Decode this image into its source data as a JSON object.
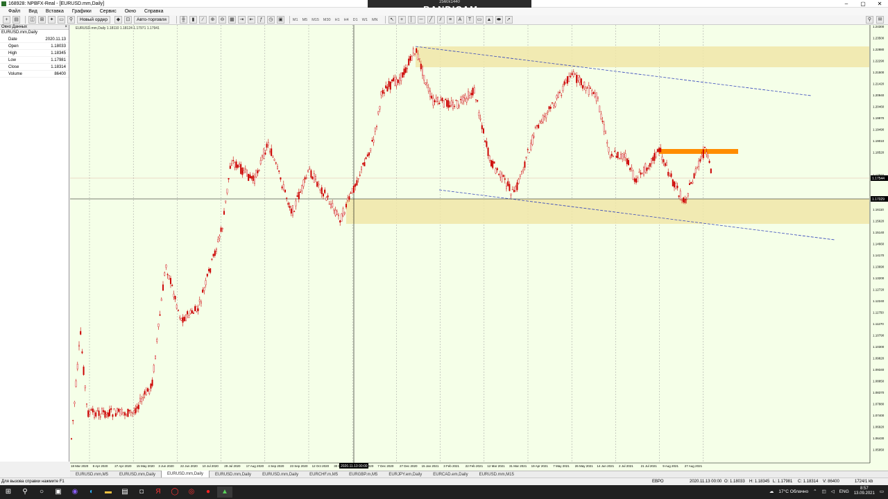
{
  "window": {
    "title": "168928: NPBFX-Real - [EURUSD.mm,Daily]"
  },
  "overlay": {
    "top_text": "2560x1440",
    "brand": "www.BANDICAM.com"
  },
  "menu": [
    "Файл",
    "Вид",
    "Вставка",
    "Графики",
    "Сервис",
    "Окно",
    "Справка"
  ],
  "toolbar": {
    "new_order": "Новый ордер",
    "autotrading": "Авто-торговля",
    "timeframes": [
      "M1",
      "M5",
      "M15",
      "M30",
      "H1",
      "H4",
      "D1",
      "W1",
      "MN"
    ]
  },
  "data_window": {
    "title": "Окно Данных",
    "symbol": "EURUSD.mm,Daily",
    "rows": [
      {
        "label": "Date",
        "value": "2020.11.13"
      },
      {
        "label": "Open",
        "value": "1.18033"
      },
      {
        "label": "High",
        "value": "1.18345"
      },
      {
        "label": "Low",
        "value": "1.17981"
      },
      {
        "label": "Close",
        "value": "1.18314"
      },
      {
        "label": "Volume",
        "value": "86400"
      }
    ]
  },
  "chart": {
    "info": "EURUSD.mm,Daily  1.18110 1.18124 1.17971 1.17941",
    "price_labels": [
      "1.24300",
      "1.23500",
      "1.22880",
      "1.22290",
      "1.21500",
      "1.21420",
      "1.20940",
      "1.20460",
      "1.19970",
      "1.19490",
      "1.19010",
      "1.18520",
      "1.17544",
      "1.17560",
      "1.17029",
      "1.16590",
      "1.16110",
      "1.15620",
      "1.15140",
      "1.14660",
      "1.14170",
      "1.13690",
      "1.13200",
      "1.12720",
      "1.12240",
      "1.11750",
      "1.11270",
      "1.10790",
      "1.10300",
      "1.09820",
      "1.09340",
      "1.08850",
      "1.08370",
      "1.07880",
      "1.07400",
      "1.06920",
      "1.06430",
      "1.05950"
    ],
    "cursor_price": "1.17029",
    "current_price": "1.17544",
    "date_labels": [
      "18 Mar 2020",
      "8 Apr 2020",
      "27 Apr 2020",
      "15 May 2020",
      "3 Jun 2020",
      "22 Jun 2020",
      "10 Jul 2020",
      "29 Jul 2020",
      "17 Aug 2020",
      "4 Sep 2020",
      "23 Sep 2020",
      "12 Oct 2020",
      "30 Oct 2020",
      "19 Nov 2020",
      "7 Dec 2020",
      "27 Dec 2020",
      "15 Jan 2021",
      "3 Feb 2021",
      "22 Feb 2021",
      "12 Mar 2021",
      "31 Mar 2021",
      "19 Apr 2021",
      "7 May 2021",
      "26 May 2021",
      "14 Jun 2021",
      "2 Jul 2021",
      "21 Jul 2021",
      "9 Aug 2021",
      "27 Aug 2021"
    ],
    "cursor_date": "2020.11.13 00:00",
    "colors": {
      "bg": "#f5ffe8",
      "candle": "#cc0000",
      "zone": "#f0e6a8",
      "resistance": "#ff8c00",
      "trendline": "#3344bb"
    }
  },
  "tabs": [
    {
      "label": "EURUSD.mm,M5",
      "active": false
    },
    {
      "label": "EURUSD.mm,Daily",
      "active": false
    },
    {
      "label": "EURUSD.mm,Daily",
      "active": true
    },
    {
      "label": "EURUSD.mm,Daily",
      "active": false
    },
    {
      "label": "EURUSD.mm,Daily",
      "active": false
    },
    {
      "label": "EURCHF.m,M5",
      "active": false
    },
    {
      "label": "EURGBP.m,M5",
      "active": false
    },
    {
      "label": "EURJPY.em,Daily",
      "active": false
    },
    {
      "label": "EURCAD.em,Daily",
      "active": false
    },
    {
      "label": "EURUSD.mm,M15",
      "active": false
    }
  ],
  "status": {
    "hint": "Для вызова справки нажмите F1",
    "profile": "ЕВРО",
    "datetime": "2020.11.13 00:00",
    "open": "O: 1.18033",
    "high": "H: 1.18345",
    "low": "L: 1.17981",
    "close": "C: 1.18314",
    "volume": "V: 86400",
    "traffic": "1724/1 kb"
  },
  "taskbar": {
    "weather": "17°C Облачно",
    "lang": "ENG",
    "time": "8:57",
    "date": "13.09.2021"
  }
}
